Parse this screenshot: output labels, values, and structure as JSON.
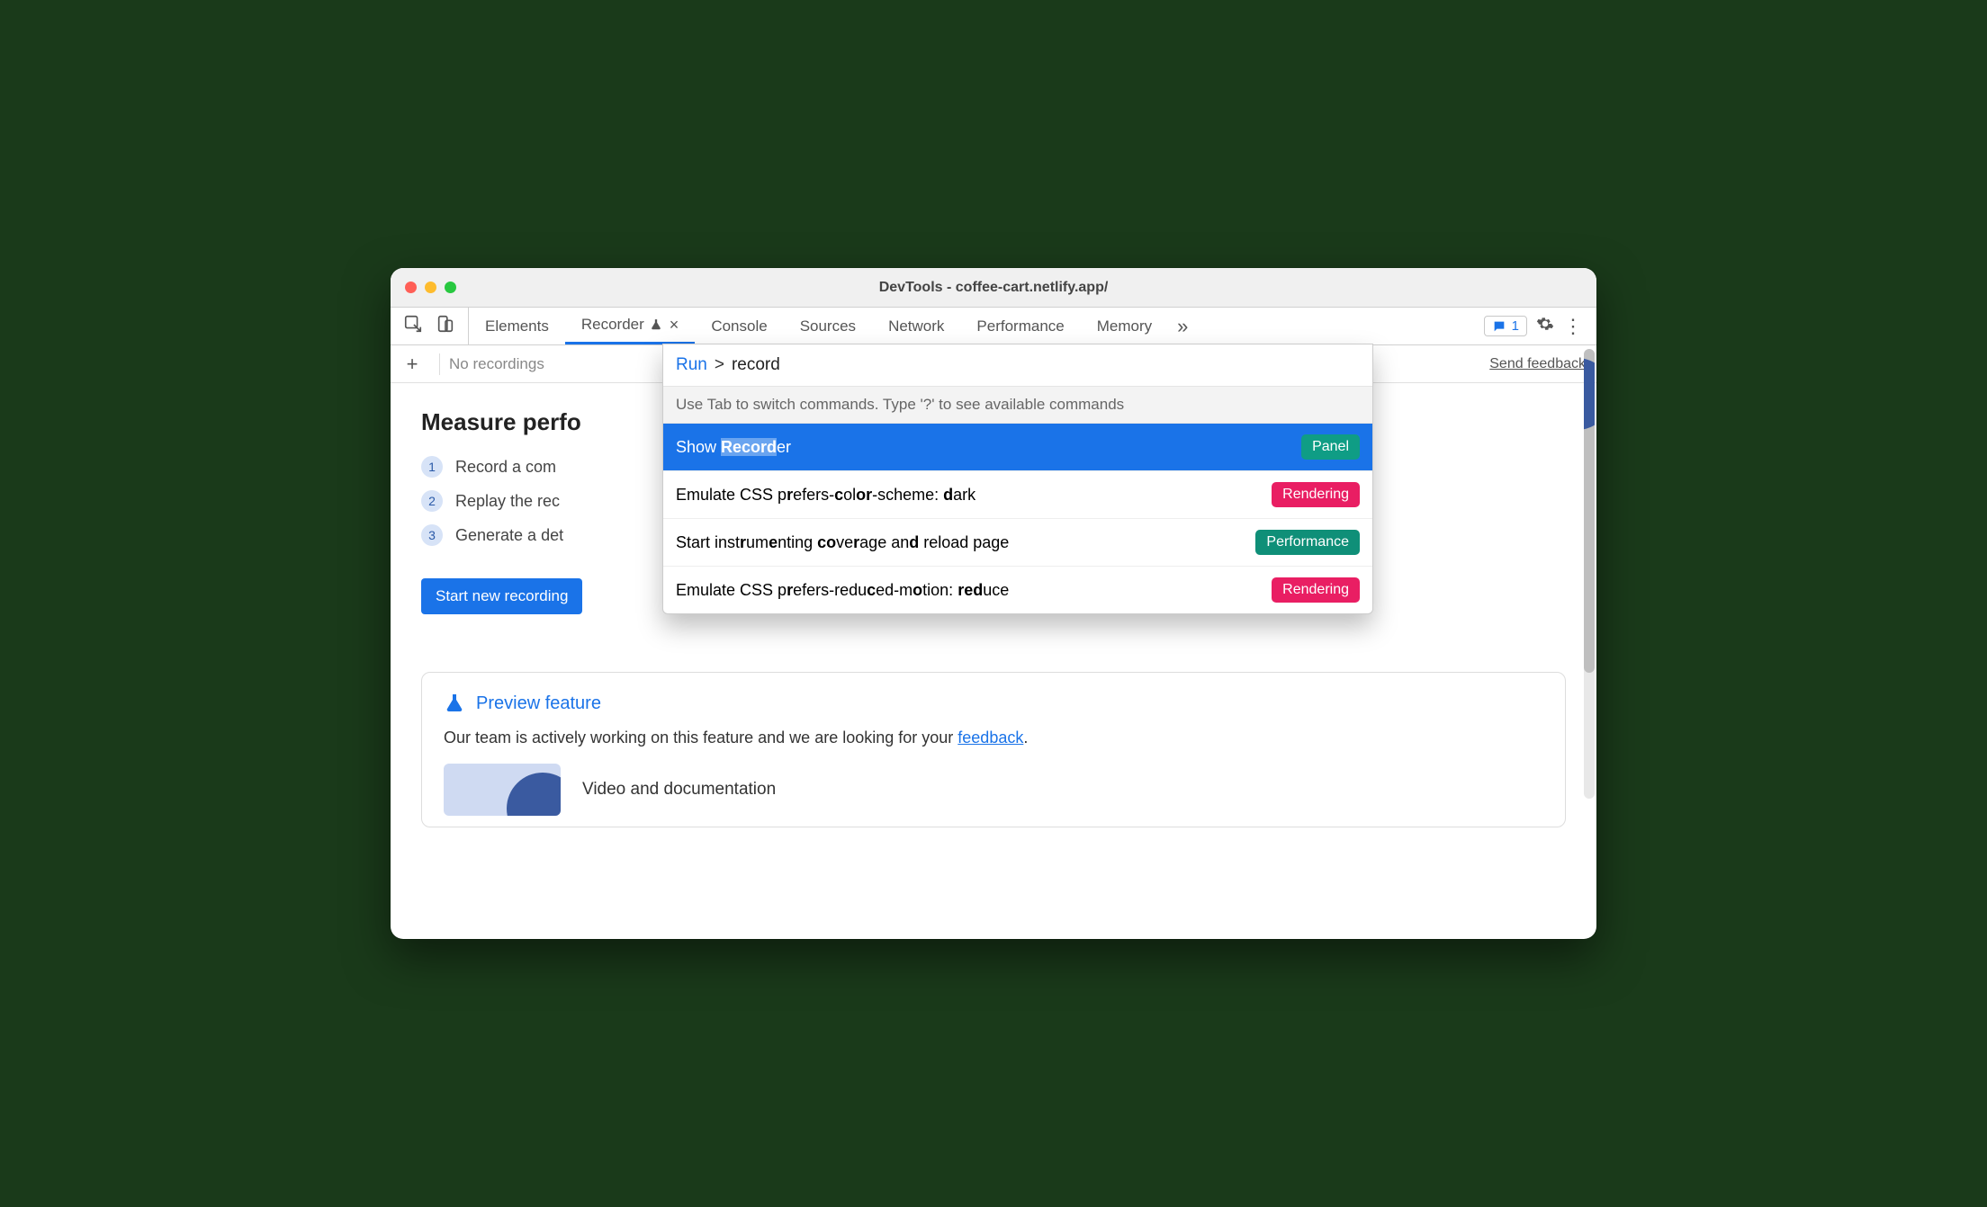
{
  "window": {
    "title": "DevTools - coffee-cart.netlify.app/"
  },
  "tabs": {
    "items": [
      "Elements",
      "Recorder",
      "Console",
      "Sources",
      "Network",
      "Performance",
      "Memory"
    ],
    "active_index": 1,
    "overflow_glyph": "»",
    "issues_count": "1"
  },
  "subbar": {
    "no_recordings": "No recordings",
    "send_feedback": "Send feedback"
  },
  "page": {
    "heading": "Measure perfo",
    "steps": [
      "Record a com",
      "Replay the rec",
      "Generate a det"
    ],
    "start_button": "Start new recording",
    "preview_title": "Preview feature",
    "preview_body_prefix": "Our team is actively working on this feature and we are looking for your ",
    "preview_body_link": "feedback",
    "preview_body_suffix": ".",
    "media_title": "Video and documentation"
  },
  "command_menu": {
    "run_label": "Run",
    "prompt_prefix": ">",
    "query": "record",
    "hint": "Use Tab to switch commands. Type '?' to see available commands",
    "items": [
      {
        "html": "Show <span class='hl'><b>Record</b></span>er",
        "badge": "Panel",
        "badge_class": "panel",
        "selected": true
      },
      {
        "html": "Emulate CSS p<b>r</b>efers-<b>c</b>ol<b>or</b>-scheme: <b>d</b>ark",
        "badge": "Rendering",
        "badge_class": "rendering",
        "selected": false
      },
      {
        "html": "Start inst<b>r</b>um<b>e</b>nting <b>co</b>ve<b>r</b>age an<b>d</b> reload page",
        "badge": "Performance",
        "badge_class": "performance",
        "selected": false
      },
      {
        "html": "Emulate CSS p<b>r</b>efers-redu<b>c</b>ed-m<b>o</b>tion: <b>red</b>uce",
        "badge": "Rendering",
        "badge_class": "rendering",
        "selected": false
      }
    ]
  }
}
